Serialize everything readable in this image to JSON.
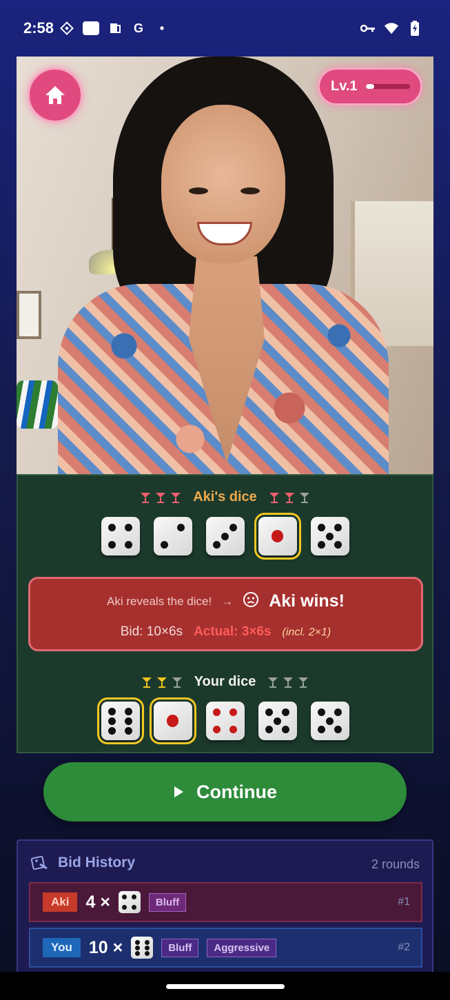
{
  "status_bar": {
    "time": "2:58",
    "left_icons": [
      "diamond-icon",
      "app-badge-icon",
      "phone-card-icon",
      "google-g-icon",
      "dot-icon"
    ],
    "right_icons": [
      "key-icon",
      "wifi-icon",
      "battery-charging-icon"
    ],
    "google_letter": "G",
    "dot": "•"
  },
  "hero": {
    "level_label": "Lv.1",
    "level_progress": 0.2
  },
  "game": {
    "opponent": {
      "title": "Aki's dice",
      "cups_left": [
        "#f06070",
        "#f06070",
        "#f06070"
      ],
      "cups_right": [
        "#f06070",
        "#f06070",
        "#9aa39e"
      ],
      "dice": [
        4,
        2,
        3,
        1,
        5
      ],
      "highlighted": [
        false,
        false,
        false,
        true,
        false
      ]
    },
    "result": {
      "reveal": "Aki reveals the dice!",
      "arrow": "→",
      "winner": "Aki wins!",
      "winner_icon": "frown-icon",
      "bid": "Bid: 10×6s",
      "actual": "Actual: 3×6s",
      "incl": "(incl. 2×1)"
    },
    "player": {
      "title": "Your dice",
      "cups_left": [
        "#f3c623",
        "#f3c623",
        "#9aa39e"
      ],
      "cups_right": [
        "#9aa39e",
        "#9aa39e",
        "#9aa39e"
      ],
      "dice": [
        6,
        1,
        4,
        5,
        5
      ],
      "highlighted": [
        true,
        true,
        false,
        false,
        false
      ]
    }
  },
  "continue_button": {
    "label": "Continue"
  },
  "history": {
    "title": "Bid History",
    "count": "2 rounds",
    "rows": [
      {
        "who": "Aki",
        "qty": "4 ×",
        "face": 4,
        "tags": [
          "Bluff"
        ],
        "num": "#1"
      },
      {
        "who": "You",
        "qty": "10 ×",
        "face": 6,
        "tags": [
          "Bluff",
          "Aggressive"
        ],
        "num": "#2"
      }
    ]
  },
  "colors": {
    "accent_pink": "#e04a7f",
    "panel_green": "#1c3a2c",
    "continue_green": "#2e8b3a",
    "result_red": "#a6302e"
  }
}
